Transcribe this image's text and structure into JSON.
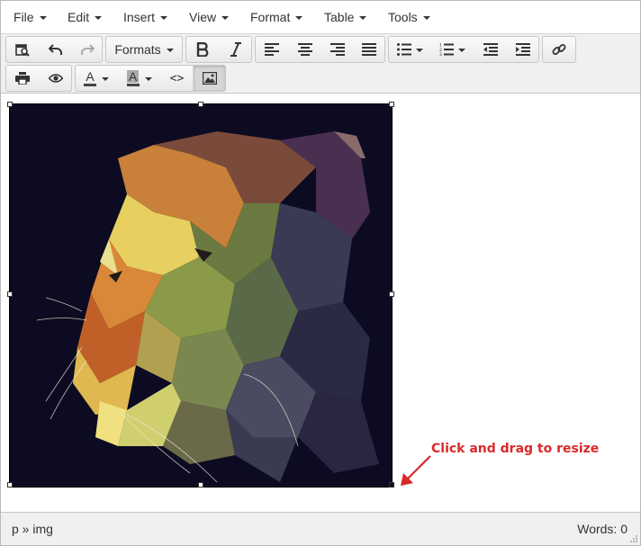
{
  "menubar": {
    "items": [
      {
        "label": "File"
      },
      {
        "label": "Edit"
      },
      {
        "label": "Insert"
      },
      {
        "label": "View"
      },
      {
        "label": "Format"
      },
      {
        "label": "Table"
      },
      {
        "label": "Tools"
      }
    ]
  },
  "toolbar": {
    "formats_label": "Formats",
    "row1_icons": [
      "preview-find-icon",
      "undo-icon",
      "redo-icon",
      "bold-icon",
      "italic-icon",
      "align-left-icon",
      "align-center-icon",
      "align-right-icon",
      "align-justify-icon",
      "bullet-list-icon",
      "numbered-list-icon",
      "outdent-icon",
      "indent-icon",
      "link-icon"
    ],
    "row2_icons": [
      "print-icon",
      "preview-icon",
      "text-color-icon",
      "background-color-icon",
      "source-code-icon",
      "image-icon"
    ],
    "text_color_glyph": "A",
    "bg_color_glyph": "A",
    "source_code_glyph": "<>"
  },
  "content": {
    "image_alt": "low-poly tiger illustration",
    "image_selected": true
  },
  "annotation": {
    "text": "Click and drag to resize",
    "color": "#d9292a"
  },
  "statusbar": {
    "path": "p » img",
    "word_count": "Words: 0"
  }
}
